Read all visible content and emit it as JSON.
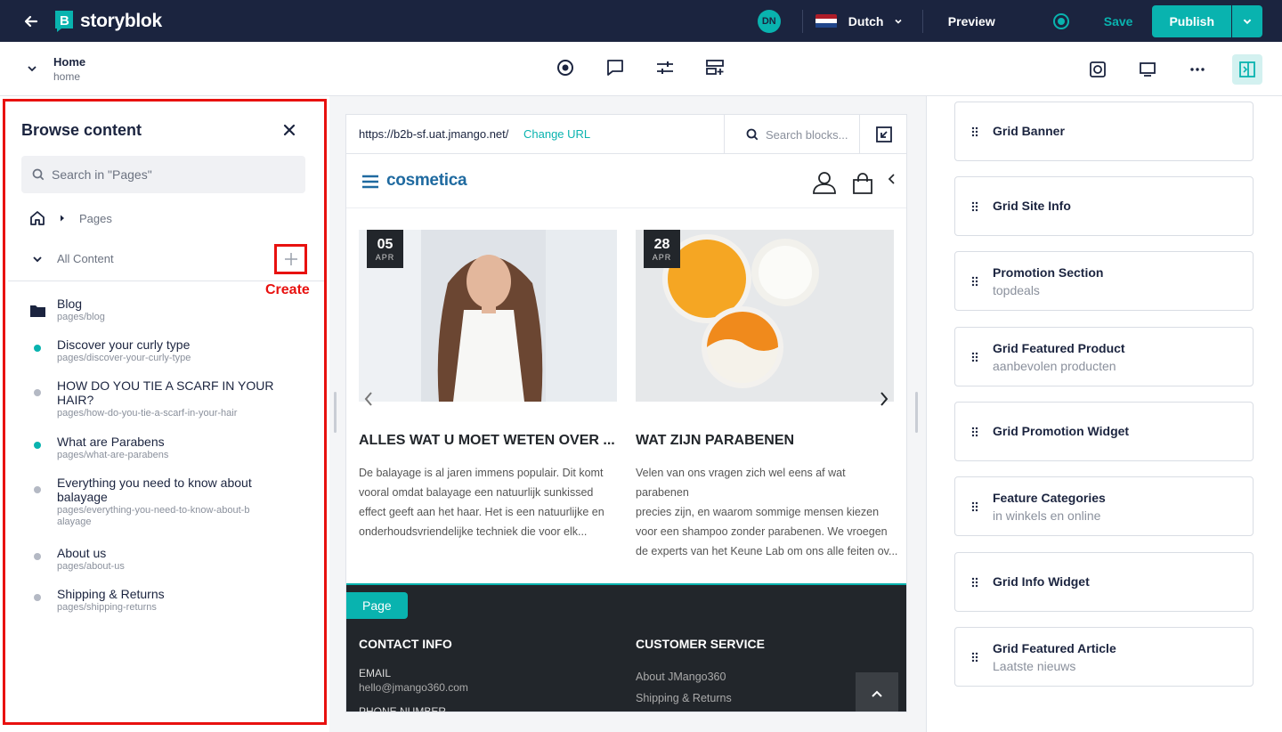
{
  "topbar": {
    "app_name": "storyblok",
    "avatar_initials": "DN",
    "language": "Dutch",
    "preview_label": "Preview",
    "save_label": "Save",
    "publish_label": "Publish",
    "accent_color": "#09b3af",
    "bar_color": "#1b243f"
  },
  "story": {
    "title": "Home",
    "slug": "home"
  },
  "center_tools": [
    "target-icon",
    "comment-icon",
    "sliders-icon",
    "add-block-icon"
  ],
  "browse": {
    "title": "Browse content",
    "search_placeholder": "Search in \"Pages\"",
    "breadcrumb_label": "Pages",
    "all_content_label": "All Content",
    "create_annotation": "Create",
    "items": [
      {
        "name": "Blog",
        "slug": "pages/blog",
        "type": "folder"
      },
      {
        "name": "Discover your curly type",
        "slug": "pages/discover-your-curly-type",
        "status": "published"
      },
      {
        "name": "HOW DO YOU TIE A SCARF IN YOUR HAIR?",
        "slug": "pages/how-do-you-tie-a-scarf-in-your-hair",
        "status": "draft"
      },
      {
        "name": "What are Parabens",
        "slug": "pages/what-are-parabens",
        "status": "published"
      },
      {
        "name": "Everything you need to know about balayage",
        "slug": "pages/everything-you-need-to-know-about-balayage",
        "status": "draft"
      },
      {
        "name": "About us",
        "slug": "pages/about-us",
        "status": "draft"
      },
      {
        "name": "Shipping & Returns",
        "slug": "pages/shipping-returns",
        "status": "draft"
      }
    ]
  },
  "preview": {
    "url": "https://b2b-sf.uat.jmango.net/",
    "change_url_label": "Change URL",
    "search_blocks_placeholder": "Search blocks...",
    "brand": "cosmetica",
    "cards": [
      {
        "day": "05",
        "month": "APR",
        "title": "ALLES WAT U MOET WETEN OVER ...",
        "lines": [
          "De balayage is al jaren immens populair. Dit komt",
          "vooral omdat balayage een natuurlijk sunkissed",
          "effect geeft aan het haar. Het is een natuurlijke en",
          "onderhoudsvriendelijke techniek die voor elk..."
        ]
      },
      {
        "day": "28",
        "month": "APR",
        "title": "WAT ZIJN PARABENEN",
        "lines": [
          "Velen van ons vragen zich wel eens af wat parabenen",
          "precies zijn, en waarom sommige mensen kiezen",
          "voor een shampoo zonder parabenen. We vroegen",
          "de experts van het Keune Lab om ons alle feiten ov..."
        ]
      }
    ],
    "footer": {
      "page_tag": "Page",
      "contact_heading": "CONTACT INFO",
      "email_label": "EMAIL",
      "email_value": "hello@jmango360.com",
      "phone_label": "PHONE NUMBER",
      "service_heading": "CUSTOMER SERVICE",
      "service_links": [
        "About JMango360",
        "Shipping & Returns"
      ]
    }
  },
  "blocks": [
    {
      "name": "Grid Banner",
      "sub": ""
    },
    {
      "name": "Grid Site Info",
      "sub": ""
    },
    {
      "name": "Promotion Section",
      "sub": "topdeals"
    },
    {
      "name": "Grid Featured Product",
      "sub": "aanbevolen producten"
    },
    {
      "name": "Grid Promotion Widget",
      "sub": ""
    },
    {
      "name": "Feature Categories",
      "sub": "in winkels en online"
    },
    {
      "name": "Grid Info Widget",
      "sub": ""
    },
    {
      "name": "Grid Featured Article",
      "sub": "Laatste nieuws"
    }
  ]
}
